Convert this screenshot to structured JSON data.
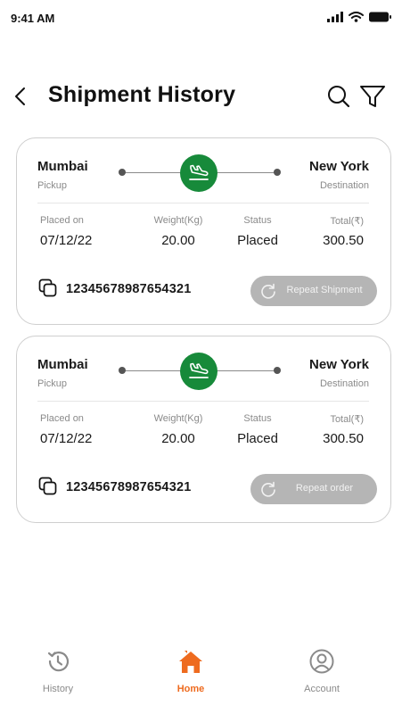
{
  "status_bar": {
    "time": "9:41 AM",
    "icons": [
      "signal-icon",
      "wifi-icon",
      "battery-icon"
    ]
  },
  "header": {
    "title": "Shipment History",
    "icons": [
      "back-arrow-icon",
      "search-icon",
      "filter-icon"
    ]
  },
  "shipments": [
    {
      "from_city": "Mumbai",
      "from_label": "Pickup",
      "to_city": "New York",
      "to_label": "Destination",
      "mode_icon": "airplane-landing-icon",
      "placed_on_label": "Placed on",
      "placed_on": "07/12/22",
      "weight_label": "Weight(Kg)",
      "weight": "20.00",
      "status_label": "Status",
      "status": "Placed",
      "total_label": "Total(₹)",
      "total": "300.50",
      "tracking_id": "12345678987654321",
      "action_label": "Repeat Shipment"
    },
    {
      "from_city": "Mumbai",
      "from_label": "Pickup",
      "to_city": "New York",
      "to_label": "Destination",
      "mode_icon": "airplane-landing-icon",
      "placed_on_label": "Placed on",
      "placed_on": "07/12/22",
      "weight_label": "Weight(Kg)",
      "weight": "20.00",
      "status_label": "Status",
      "status": "Placed",
      "total_label": "Total(₹)",
      "total": "300.50",
      "tracking_id": "12345678987654321",
      "action_label": "Repeat order"
    }
  ],
  "bottom_nav": {
    "items": [
      {
        "label": "History",
        "icon": "history-icon",
        "active": false
      },
      {
        "label": "Home",
        "icon": "home-icon",
        "active": true
      },
      {
        "label": "Account",
        "icon": "account-icon",
        "active": false
      }
    ]
  },
  "colors": {
    "accent": "#ee6b1f",
    "transport_badge": "#178a3a",
    "disabled_button": "#b5b5b5",
    "muted_text": "#8a8a8a"
  }
}
